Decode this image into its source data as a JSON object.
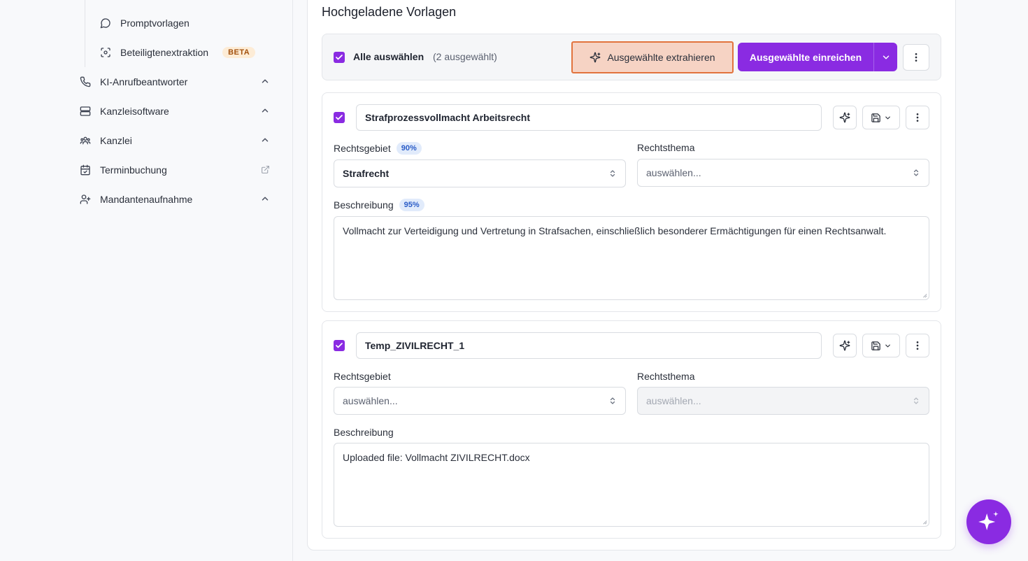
{
  "sidebar": {
    "items": [
      {
        "label": "Promptvorlagen",
        "icon": "chat-bubble-icon"
      },
      {
        "label": "Beteiligtenextraktion",
        "icon": "scan-face-icon",
        "badge": "BETA"
      },
      {
        "label": "KI-Anrufbeantworter",
        "icon": "phone-icon"
      },
      {
        "label": "Kanzleisoftware",
        "icon": "server-icon"
      },
      {
        "label": "Kanzlei",
        "icon": "users-icon"
      },
      {
        "label": "Terminbuchung",
        "icon": "calendar-check-icon"
      },
      {
        "label": "Mandantenaufnahme",
        "icon": "user-plus-icon"
      }
    ]
  },
  "main": {
    "title": "Hochgeladene Vorlagen",
    "toolbar": {
      "select_all_label": "Alle auswählen",
      "selected_count": "(2 ausgewählt)",
      "extract_label": "Ausgewählte extrahieren",
      "submit_label": "Ausgewählte einreichen"
    },
    "templates": [
      {
        "name": "Strafprozessvollmacht Arbeitsrecht",
        "rechtsgebiet_label": "Rechtsgebiet",
        "rechtsgebiet_confidence": "90%",
        "rechtsgebiet_value": "Strafrecht",
        "rechtsthema_label": "Rechtsthema",
        "rechtsthema_value": "auswählen...",
        "beschreibung_label": "Beschreibung",
        "beschreibung_confidence": "95%",
        "beschreibung_value": "Vollmacht zur Verteidigung und Vertretung in Strafsachen, einschließlich besonderer Ermächtigungen für einen Rechtsanwalt."
      },
      {
        "name": "Temp_ZIVILRECHT_1",
        "rechtsgebiet_label": "Rechtsgebiet",
        "rechtsgebiet_value": "auswählen...",
        "rechtsthema_label": "Rechtsthema",
        "rechtsthema_value": "auswählen...",
        "beschreibung_label": "Beschreibung",
        "beschreibung_value": "Uploaded file: Vollmacht ZIVILRECHT.docx"
      }
    ]
  },
  "colors": {
    "accent": "#8a2be2",
    "highlight_border": "#e2733d",
    "highlight_bg": "#f6d3c4",
    "beta_bg": "#fdecd6",
    "confidence_bg": "#e1ebfb"
  }
}
